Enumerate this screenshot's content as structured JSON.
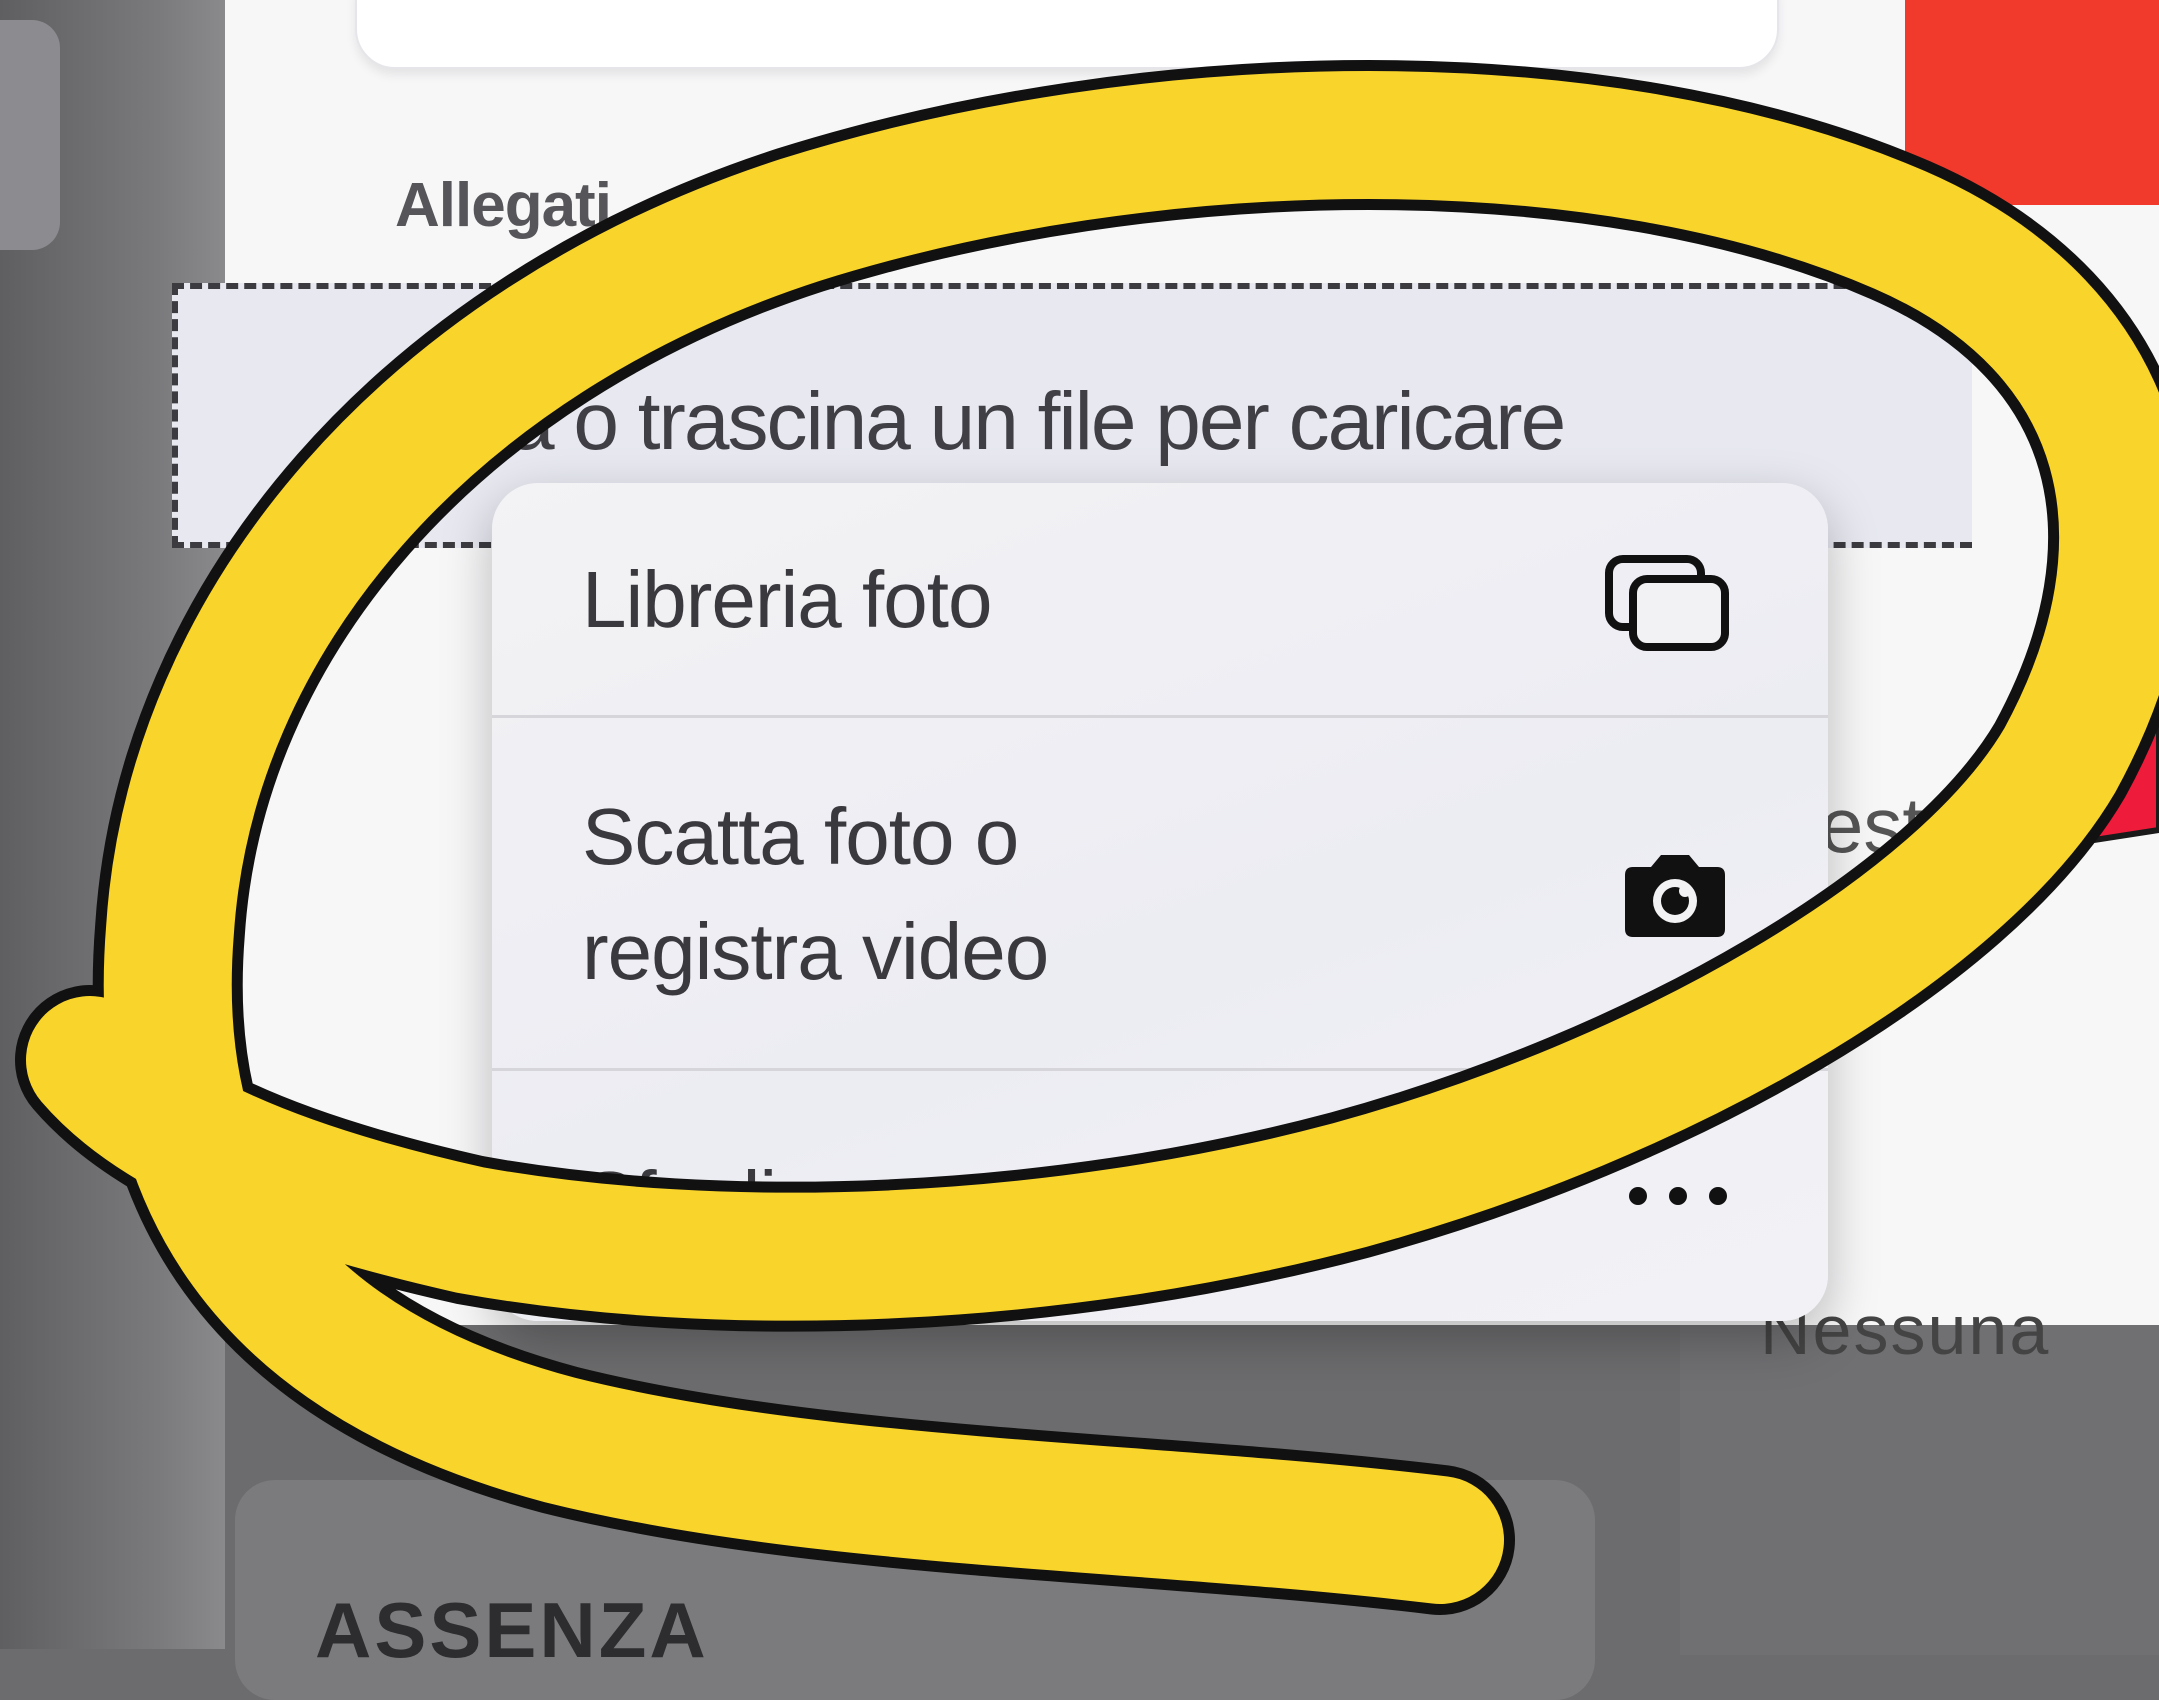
{
  "form": {
    "attachments_label": "Allegati",
    "dropzone_text": "ca o trascina un file per caricare",
    "partial_right_text": "est",
    "partial_bottom_text": "Nessuna",
    "section_label": "ASSENZA"
  },
  "menu": {
    "items": [
      {
        "label": "Libreria foto",
        "icon": "photo-library-icon"
      },
      {
        "label_line1": "Scatta foto o",
        "label_line2": "registra video",
        "icon": "camera-icon"
      },
      {
        "label": "Sfoglia",
        "icon": "more-icon"
      }
    ]
  },
  "colors": {
    "highlight_yellow": "#f9d42a",
    "arrow_red": "#ee1c3a",
    "header_red": "#f23a2c"
  }
}
